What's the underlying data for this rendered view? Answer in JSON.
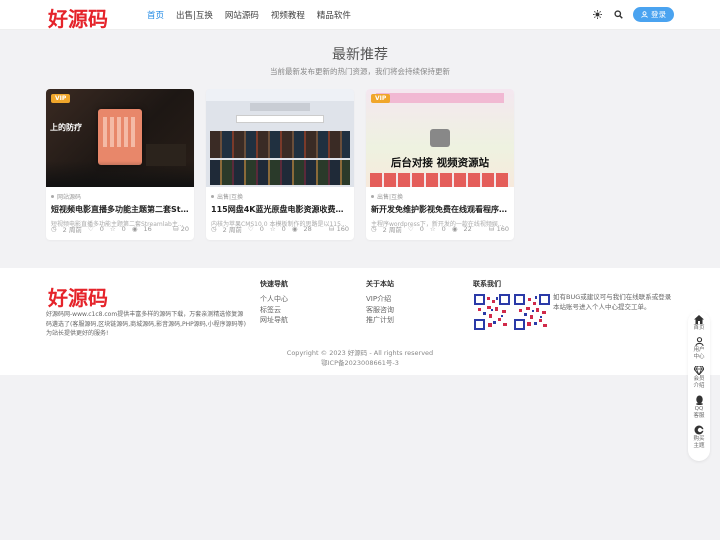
{
  "header": {
    "logo": "好源码",
    "nav": [
      "首页",
      "出售|互换",
      "网站源码",
      "视频教程",
      "精品软件"
    ],
    "login": "登录"
  },
  "section": {
    "title": "最新推荐",
    "subtitle": "当前最新发布更新的热门资源，我们将会持续保持更新"
  },
  "cards": [
    {
      "vip": "VIP",
      "category": "网站源码",
      "title": "短视频电影直播多功能主题第二套Str...",
      "desc": "短视频电影直播多功能主题第二套Streamlab主...",
      "time": "2 周前",
      "likes": "0",
      "favs": "0",
      "views": "16",
      "downloads": "20",
      "thumb_text": "上的防疗"
    },
    {
      "vip": "",
      "category": "出售|互换",
      "title": "115网盘4K蓝光原盘电影资源收费分...",
      "desc": "内核为苹果CMS10.0  本模板制作的思路是以115...",
      "time": "2 周前",
      "likes": "0",
      "favs": "0",
      "views": "28",
      "downloads": "160",
      "thumb_text": ""
    },
    {
      "vip": "VIP",
      "category": "出售|互换",
      "title": "新开发免维护影视免费在线观看程序 后...",
      "desc": "主程序wordpress下，新开发的一款在线视频娱...",
      "time": "2 周前",
      "likes": "0",
      "favs": "0",
      "views": "22",
      "downloads": "160",
      "thumb_text": "后台对接 视频资源站"
    }
  ],
  "footer": {
    "logo": "好源码",
    "desc": "好源码网-www.c1c8.com提供丰富多样的源码下载，万套亲测精选修复源码遴选了(客服源码,区块链源码,商城源码,影音源码,PHP源码,小程序源码等)为站长提供更好的服务!",
    "col1": {
      "title": "快速导航",
      "links": [
        "个人中心",
        "标签云",
        "网址导航"
      ]
    },
    "col2": {
      "title": "关于本站",
      "links": [
        "VIP介绍",
        "客服咨询",
        "推广计划"
      ]
    },
    "col3": {
      "title": "联系我们"
    },
    "contact_text": "如有BUG或建议可与我们在线联系或登录本站账号进入个人中心提交工单。",
    "copyright": "Copyright © 2023 好源码 - All rights reserved",
    "icp": "鄂ICP备2023008661号-3"
  },
  "float_bar": [
    "首页",
    "用户中心",
    "会员介绍",
    "QQ客服",
    "购买主题"
  ],
  "colors": {
    "brand": "#e5242b",
    "accent": "#1e88e5",
    "vip": "#f0a62b"
  }
}
